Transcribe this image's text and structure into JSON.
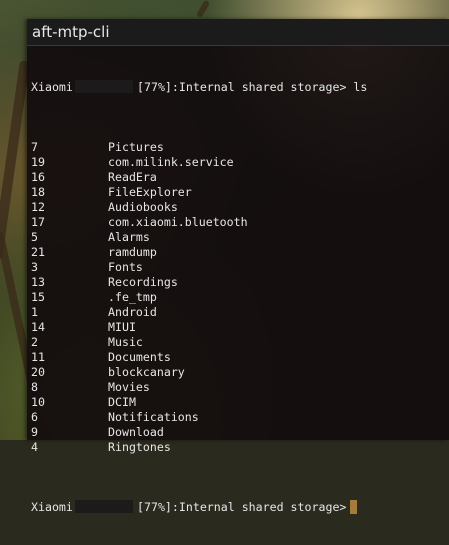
{
  "window": {
    "title": "aft-mtp-cli"
  },
  "prompt": {
    "device": "Xiaomi",
    "rest": "[77%]:Internal shared storage>",
    "command": "ls"
  },
  "listing": [
    {
      "count": "7",
      "name": "Pictures"
    },
    {
      "count": "19",
      "name": "com.milink.service"
    },
    {
      "count": "16",
      "name": "ReadEra"
    },
    {
      "count": "18",
      "name": "FileExplorer"
    },
    {
      "count": "12",
      "name": "Audiobooks"
    },
    {
      "count": "17",
      "name": "com.xiaomi.bluetooth"
    },
    {
      "count": "5",
      "name": "Alarms"
    },
    {
      "count": "21",
      "name": "ramdump"
    },
    {
      "count": "3",
      "name": "Fonts"
    },
    {
      "count": "13",
      "name": "Recordings"
    },
    {
      "count": "15",
      "name": ".fe_tmp"
    },
    {
      "count": "1",
      "name": "Android"
    },
    {
      "count": "14",
      "name": "MIUI"
    },
    {
      "count": "2",
      "name": "Music"
    },
    {
      "count": "11",
      "name": "Documents"
    },
    {
      "count": "20",
      "name": "blockcanary"
    },
    {
      "count": "8",
      "name": "Movies"
    },
    {
      "count": "10",
      "name": "DCIM"
    },
    {
      "count": "6",
      "name": "Notifications"
    },
    {
      "count": "9",
      "name": "Download"
    },
    {
      "count": "4",
      "name": "Ringtones"
    }
  ],
  "colors": {
    "terminal_bg": "#120c0e",
    "text": "#e6e6e6",
    "cursor": "#a67a3a"
  }
}
